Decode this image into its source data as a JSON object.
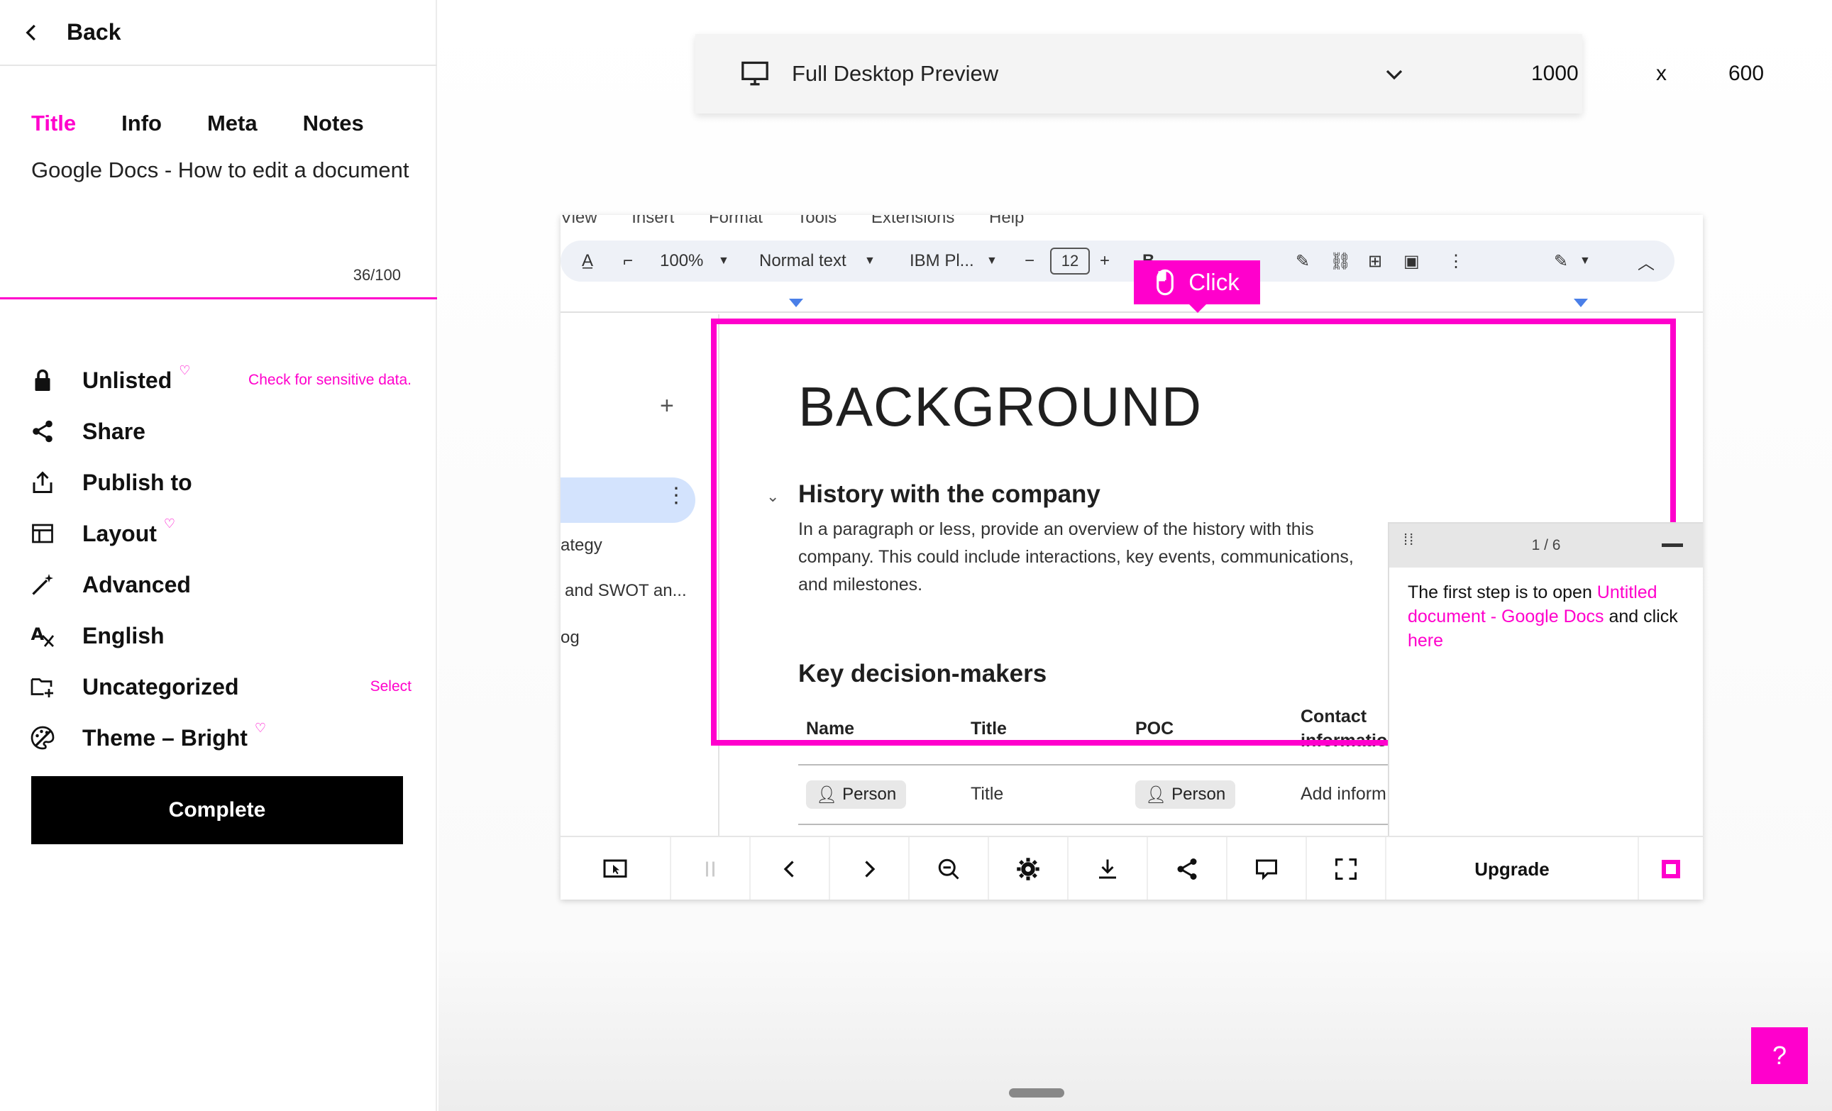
{
  "sidebar": {
    "back_label": "Back",
    "tabs": [
      {
        "label": "Title",
        "active": true
      },
      {
        "label": "Info",
        "active": false
      },
      {
        "label": "Meta",
        "active": false
      },
      {
        "label": "Notes",
        "active": false
      }
    ],
    "title_value": "Google Docs - How to edit a document",
    "char_count": "36/100",
    "menu": [
      {
        "label": "Unlisted",
        "icon": "lock-icon",
        "gem": true,
        "side_link": "Check for sensitive data."
      },
      {
        "label": "Share",
        "icon": "share-icon",
        "gem": false,
        "side_link": ""
      },
      {
        "label": "Publish to",
        "icon": "upload-icon",
        "gem": false,
        "side_link": ""
      },
      {
        "label": "Layout",
        "icon": "layout-icon",
        "gem": true,
        "side_link": ""
      },
      {
        "label": "Advanced",
        "icon": "magic-wand-icon",
        "gem": false,
        "side_link": ""
      },
      {
        "label": "English",
        "icon": "translate-icon",
        "gem": false,
        "side_link": ""
      },
      {
        "label": "Uncategorized",
        "icon": "folder-add-icon",
        "gem": false,
        "side_link": "Select"
      },
      {
        "label": "Theme – Bright",
        "icon": "palette-icon",
        "gem": true,
        "side_link": ""
      }
    ],
    "complete_label": "Complete"
  },
  "preview": {
    "mode_label": "Full Desktop Preview",
    "width": "1000",
    "x_sep": "x",
    "height": "600"
  },
  "gdoc": {
    "menu": [
      "View",
      "Insert",
      "Format",
      "Tools",
      "Extensions",
      "Help"
    ],
    "zoom": "100%",
    "style": "Normal text",
    "font": "IBM Pl...",
    "font_size": "12",
    "outline": [
      "ategy",
      "and SWOT an...",
      "og"
    ],
    "heading": "BACKGROUND",
    "h2": "History with the company",
    "paragraph": "In a paragraph or less, provide an overview of the history with this company. This could include interactions, key events, communications, and milestones.",
    "h2b": "Key decision-makers",
    "table_headers": [
      "Name",
      "Title",
      "POC",
      "Contact information"
    ],
    "row": {
      "name": "Person",
      "title": "Title",
      "poc": "Person",
      "contact": "Add inform"
    }
  },
  "click_badge": "Click",
  "step": {
    "counter": "1 / 6",
    "text_before": "The first step is to open ",
    "link_text": "Untitled document - Google Docs",
    "text_mid": " and click ",
    "link_here": "here"
  },
  "controls": {
    "upgrade_label": "Upgrade"
  },
  "help_label": "?",
  "accent_color": "#ff00cc"
}
